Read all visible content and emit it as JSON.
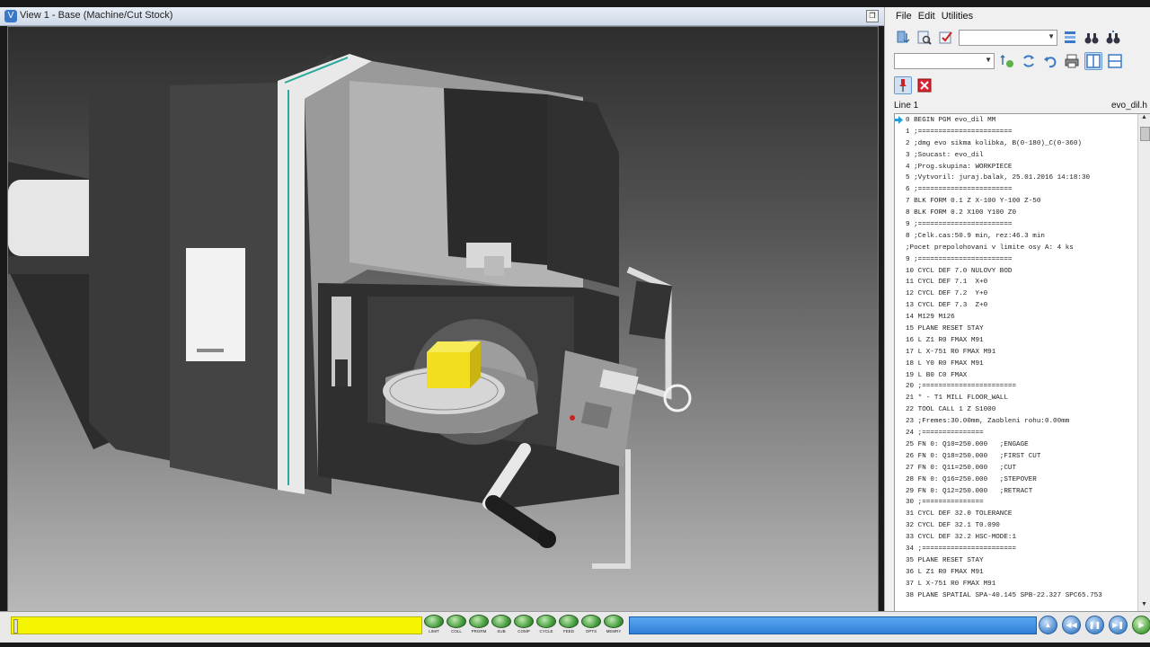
{
  "window": {
    "title": "View 1 - Base (Machine/Cut Stock)",
    "restore_glyph": "❐"
  },
  "menu": [
    "File",
    "Edit",
    "Utilities"
  ],
  "toolbar": {
    "row1_icons": [
      "sort-down-icon",
      "find-icon",
      "verify-icon"
    ],
    "row1_right_icons": [
      "layout-icon",
      "binoculars-icon",
      "binoculars-next-icon"
    ],
    "row2_icons": [
      "tools-icon",
      "refresh-icon",
      "undo-icon",
      "print-icon",
      "split-vertical-icon",
      "split-horizontal-icon"
    ],
    "row3_icons": [
      "pin-icon",
      "close-icon"
    ]
  },
  "code_panel": {
    "line_label": "Line 1",
    "file_name": "evo_dil.h",
    "lines": [
      "0 BEGIN PGM evo_dil MM",
      "1 ;=======================",
      "2 ;dmg evo sikma kolibka, B(0-180)_C(0-360)",
      "3 ;Soucast: evo_dil",
      "4 ;Prog.skupina: WORKPIECE",
      "5 ;Vytvoril: juraj.balak, 25.01.2016 14:18:30",
      "6 ;=======================",
      "7 BLK FORM 0.1 Z X-100 Y-100 Z-50",
      "8 BLK FORM 0.2 X100 Y100 Z0",
      "9 ;=======================",
      "8 ;Celk.cas:50.9 min, rez:46.3 min",
      ";Pocet prepolohovani v limite osy A: 4 ks",
      "9 ;=======================",
      "10 CYCL DEF 7.0 NULOVY BOD",
      "11 CYCL DEF 7.1  X+0",
      "12 CYCL DEF 7.2  Y+0",
      "13 CYCL DEF 7.3  Z+0",
      "14 M129 M126",
      "15 PLANE RESET STAY",
      "16 L Z1 R0 FMAX M91",
      "17 L X-751 R0 FMAX M91",
      "18 L Y0 R0 FMAX M91",
      "19 L B0 C0 FMAX",
      "20 ;=======================",
      "21 * - T1 MILL FLOOR_WALL",
      "22 TOOL CALL 1 Z S1000",
      "23 ;Fremes:30.00mm, Zaobleni rohu:0.00mm",
      "24 ;===============",
      "25 FN 0: Q10=250.000   ;ENGAGE",
      "26 FN 0: Q18=250.000   ;FIRST CUT",
      "27 FN 0: Q11=250.000   ;CUT",
      "28 FN 0: Q16=250.000   ;STEPOVER",
      "29 FN 0: Q12=250.000   ;RETRACT",
      "30 ;===============",
      "31 CYCL DEF 32.0 TOLERANCE",
      "32 CYCL DEF 32.1 T0.090",
      "33 CYCL DEF 32.2 HSC-MODE:1",
      "34 ;=======================",
      "35 PLANE RESET STAY",
      "36 L Z1 R0 FMAX M91",
      "37 L X-751 R0 FMAX M91",
      "38 PLANE SPATIAL SPA-40.145 SPB-22.327 SPC65.753"
    ]
  },
  "status_buttons": [
    "LIMIT",
    "COLL",
    "PRGRM",
    "SUB",
    "COMP",
    "CYCLE",
    "FEED",
    "OPTS",
    "MEMRY"
  ],
  "playback_icons": [
    "step-back-icon",
    "rewind-icon",
    "pause-icon",
    "play-icon",
    "run-to-end-icon"
  ],
  "colors": {
    "progress_yellow": "#f5f500",
    "progress_blue": "#2f7fd6",
    "status_led": "#48a040",
    "workpiece": "#f2de1f"
  }
}
